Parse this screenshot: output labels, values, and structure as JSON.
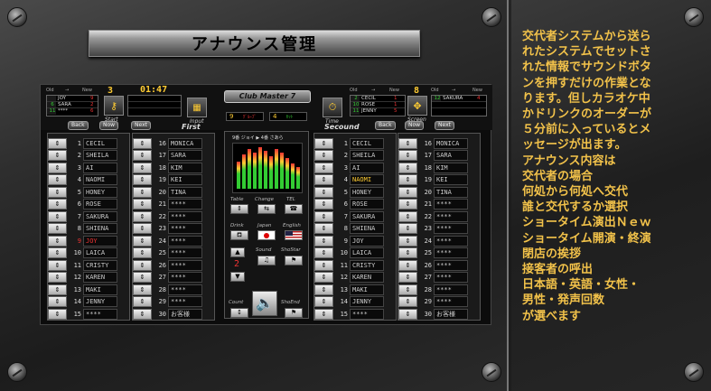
{
  "title": "アナウンス管理",
  "description_lines": [
    "交代者システムから送ら",
    "れたシステムでセットさ",
    "れた情報でサウンドボタ",
    "ンを押すだけの作業とな",
    "ります。但しカラオケ中",
    "かドリンクのオーダーが",
    "５分前に入っているとメ",
    "ッセージが出ます。",
    "アナウンス内容は",
    "交代者の場合",
    "何処から何処へ交代",
    "誰と交代するか選択",
    "ショータイム演出Ｎｅｗ",
    "ショータイム開演・終演",
    "閉店の挨拶",
    "接客者の呼出",
    "日本語・英語・女性・",
    "男性・発声回数",
    "が選べます"
  ],
  "app": {
    "logo": "Club Master 7",
    "clock": "01:47",
    "left_header": {
      "old": "Old",
      "arrow": "→",
      "new": "New",
      "count": "3"
    },
    "right_header": {
      "old": "Old",
      "arrow": "→",
      "new": "New",
      "count": "8"
    },
    "left_old": [
      {
        "num": "",
        "name": "JOY",
        "val": "9"
      },
      {
        "num": "6",
        "name": "SARA",
        "val": "2"
      },
      {
        "num": "11",
        "name": "****",
        "val": "6"
      }
    ],
    "right_new": [
      {
        "num": "2",
        "name": "CECIL",
        "val": "1"
      },
      {
        "num": "10",
        "name": "ROSE",
        "val": "1"
      },
      {
        "num": "11",
        "name": "JENNY",
        "val": "5"
      }
    ],
    "far_right": {
      "num": "12",
      "name": "SAKURA",
      "val": "4"
    },
    "start_label": "Start",
    "input_label": "Input",
    "time_label": "Time",
    "screen_label": "Screen",
    "first_label": "First",
    "second_label": "Secound",
    "back": "Back",
    "now": "Now",
    "next": "Next",
    "left_counter_a": "9",
    "left_counter_b": "4",
    "left_counter_a_text": "ｸﾞﾙｰﾌﾟ",
    "left_counter_b_text": "ｾｯﾄ",
    "eq_caption": "9番 ジョイ ▶ 4番 さあら",
    "labels": {
      "table": "Table",
      "change": "Change",
      "tel": "TEL",
      "drink": "Drink",
      "japan": "Japan",
      "english": "English",
      "sound": "Sound",
      "showstar": "ShoStar",
      "count": "Count",
      "shostime": "ShoEnd"
    },
    "count_value": "2",
    "left_list_a": [
      {
        "n": "1",
        "name": "CECIL"
      },
      {
        "n": "2",
        "name": "SHEILA"
      },
      {
        "n": "3",
        "name": "AI"
      },
      {
        "n": "4",
        "name": "NAOMI"
      },
      {
        "n": "5",
        "name": "HONEY"
      },
      {
        "n": "6",
        "name": "ROSE"
      },
      {
        "n": "7",
        "name": "SAKURA"
      },
      {
        "n": "8",
        "name": "SHIENA"
      },
      {
        "n": "9",
        "name": "JOY"
      },
      {
        "n": "10",
        "name": "LAICA"
      },
      {
        "n": "11",
        "name": "CRISTY"
      },
      {
        "n": "12",
        "name": "KAREN"
      },
      {
        "n": "13",
        "name": "MAKI"
      },
      {
        "n": "14",
        "name": "JENNY"
      },
      {
        "n": "15",
        "name": "****"
      }
    ],
    "left_list_b": [
      {
        "n": "16",
        "name": "MONICA"
      },
      {
        "n": "17",
        "name": "SARA"
      },
      {
        "n": "18",
        "name": "KIM"
      },
      {
        "n": "19",
        "name": "KEI"
      },
      {
        "n": "20",
        "name": "TINA"
      },
      {
        "n": "21",
        "name": "****"
      },
      {
        "n": "22",
        "name": "****"
      },
      {
        "n": "23",
        "name": "****"
      },
      {
        "n": "24",
        "name": "****"
      },
      {
        "n": "25",
        "name": "****"
      },
      {
        "n": "26",
        "name": "****"
      },
      {
        "n": "27",
        "name": "****"
      },
      {
        "n": "28",
        "name": "****"
      },
      {
        "n": "29",
        "name": "****"
      },
      {
        "n": "30",
        "name": "お客様"
      }
    ],
    "right_list_a": [
      {
        "n": "1",
        "name": "CECIL"
      },
      {
        "n": "2",
        "name": "SHEILA"
      },
      {
        "n": "3",
        "name": "AI"
      },
      {
        "n": "4",
        "name": "NAOMI"
      },
      {
        "n": "5",
        "name": "HONEY"
      },
      {
        "n": "6",
        "name": "ROSE"
      },
      {
        "n": "7",
        "name": "SAKURA"
      },
      {
        "n": "8",
        "name": "SHIENA"
      },
      {
        "n": "9",
        "name": "JOY"
      },
      {
        "n": "10",
        "name": "LAICA"
      },
      {
        "n": "11",
        "name": "CRISTY"
      },
      {
        "n": "12",
        "name": "KAREN"
      },
      {
        "n": "13",
        "name": "MAKI"
      },
      {
        "n": "14",
        "name": "JENNY"
      },
      {
        "n": "15",
        "name": "****"
      }
    ],
    "right_list_b": [
      {
        "n": "16",
        "name": "MONICA"
      },
      {
        "n": "17",
        "name": "SARA"
      },
      {
        "n": "18",
        "name": "KIM"
      },
      {
        "n": "19",
        "name": "KEI"
      },
      {
        "n": "20",
        "name": "TINA"
      },
      {
        "n": "21",
        "name": "****"
      },
      {
        "n": "22",
        "name": "****"
      },
      {
        "n": "23",
        "name": "****"
      },
      {
        "n": "24",
        "name": "****"
      },
      {
        "n": "25",
        "name": "****"
      },
      {
        "n": "26",
        "name": "****"
      },
      {
        "n": "27",
        "name": "****"
      },
      {
        "n": "28",
        "name": "****"
      },
      {
        "n": "29",
        "name": "****"
      },
      {
        "n": "30",
        "name": "お客様"
      }
    ],
    "selected_left": "9",
    "selected_right": "4"
  }
}
